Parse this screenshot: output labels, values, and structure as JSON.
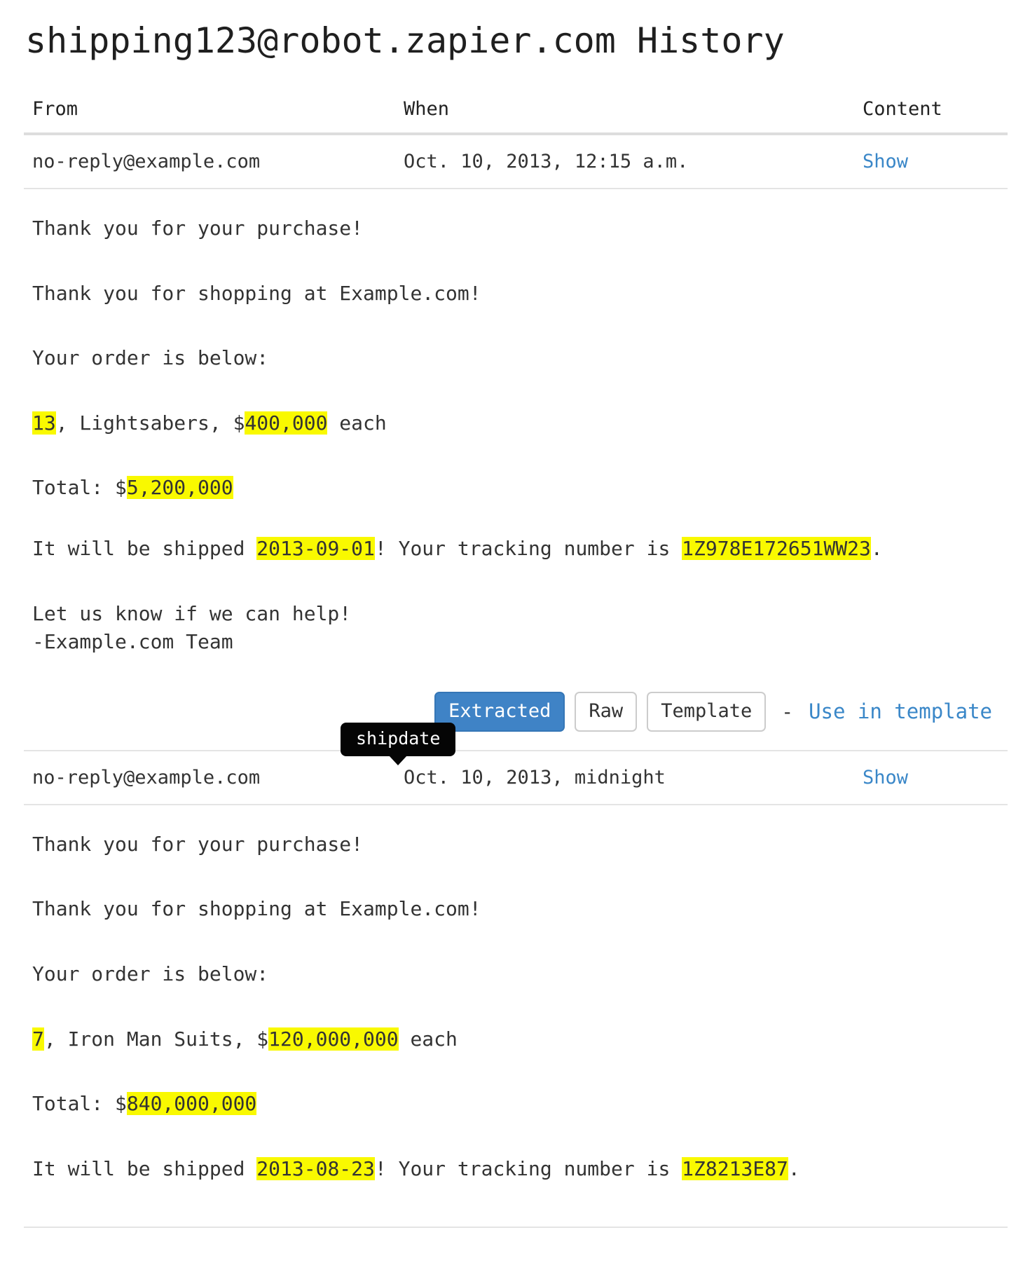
{
  "page": {
    "title": "shipping123@robot.zapier.com History"
  },
  "table": {
    "headers": {
      "from": "From",
      "when": "When",
      "content": "Content"
    }
  },
  "emails": [
    {
      "from": "no-reply@example.com",
      "when": "Oct. 10, 2013, 12:15 a.m.",
      "show_label": "Show",
      "body": {
        "line1": "Thank you for your purchase!",
        "line2": "Thank you for shopping at Example.com!",
        "line3": "Your order is below:",
        "order_qty": "13",
        "order_mid": ", Lightsabers, $",
        "order_price": "400,000",
        "order_tail": " each",
        "total_label": "Total: $",
        "total_value": "5,200,000",
        "ship_prefix": "It will be shipped ",
        "ship_date": "2013-09-01",
        "ship_mid": "! Your tracking number is ",
        "tracking": "1Z978E172651WW23",
        "ship_suffix": ".",
        "closing1": "Let us know if we can help!",
        "closing2": "-Example.com Team"
      },
      "tooltip": "shipdate",
      "toolbar": {
        "extracted": "Extracted",
        "raw": "Raw",
        "template": "Template",
        "dash": "-",
        "use_in_template": "Use in template"
      }
    },
    {
      "from": "no-reply@example.com",
      "when": "Oct. 10, 2013, midnight",
      "show_label": "Show",
      "body": {
        "line1": "Thank you for your purchase!",
        "line2": "Thank you for shopping at Example.com!",
        "line3": "Your order is below:",
        "order_qty": "7",
        "order_mid": ", Iron Man Suits, $",
        "order_price": "120,000,000",
        "order_tail": " each",
        "total_label": "Total: $",
        "total_value": "840,000,000",
        "ship_prefix": "It will be shipped ",
        "ship_date": "2013-08-23",
        "ship_mid": "! Your tracking number is ",
        "tracking": "1Z8213E87",
        "ship_suffix": "."
      }
    }
  ],
  "colors": {
    "highlight": "#f9f900",
    "link": "#3a87c8",
    "primary_button": "#3f83c6",
    "tooltip_bg": "#050505"
  }
}
